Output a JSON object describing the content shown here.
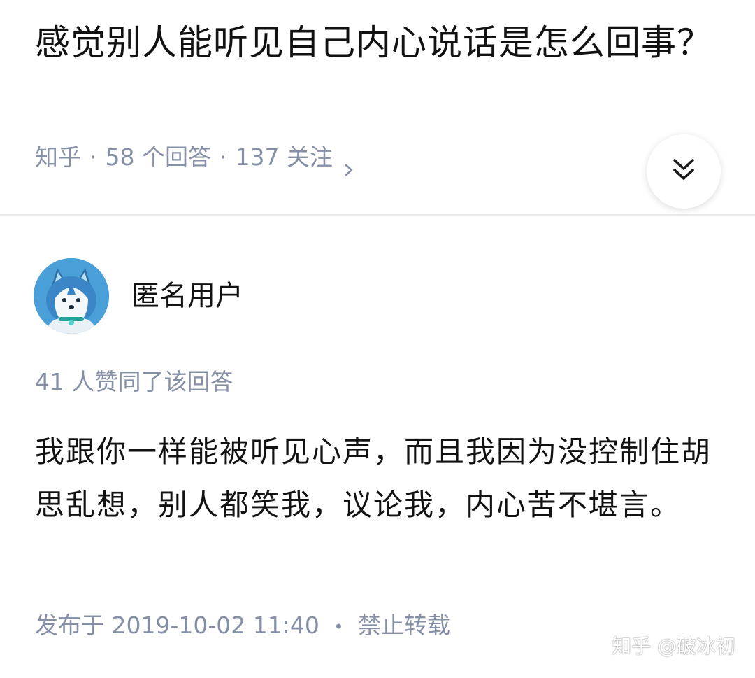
{
  "question": {
    "title": "感觉别人能听见自己内心说话是怎么回事？",
    "source": "知乎",
    "answers_count": "58 个回答",
    "followers_count": "137 关注",
    "separator": "·"
  },
  "answer": {
    "author_name": "匿名用户",
    "vote_info": "41 人赞同了该回答",
    "content": "我跟你一样能被听见心声，而且我因为没控制住胡思乱想，别人都笑我，议论我，内心苦不堪言。",
    "publish_label": "发布于 2019-10-02 11:40",
    "bullet": "•",
    "copyright": "禁止转载"
  },
  "watermark": "知乎 @破冰初",
  "icons": {
    "meta_chevron": "chevron-right-icon",
    "expand": "double-chevron-down-icon",
    "avatar": "anonymous-husky-avatar"
  },
  "colors": {
    "meta_text": "#8590a6",
    "primary_text": "#121212",
    "avatar_bg": "#4a9fd8",
    "divider": "#ebebeb"
  }
}
